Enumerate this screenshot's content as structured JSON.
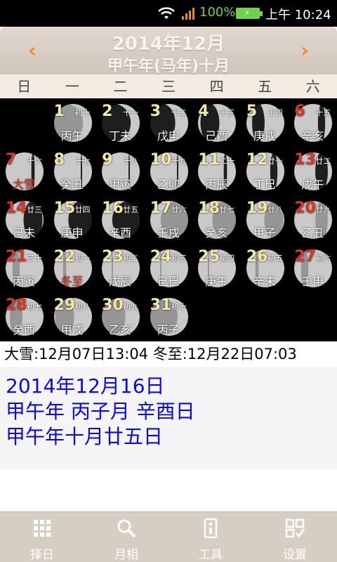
{
  "status": {
    "battery": "100%",
    "time": "上午 10:24"
  },
  "header": {
    "title": "2014年12月",
    "subtitle": "甲午年(马年)十月",
    "prev": "‹",
    "next": "›"
  },
  "weekdays": [
    "日",
    "一",
    "二",
    "三",
    "四",
    "五",
    "六"
  ],
  "days": [
    {
      "d": "1",
      "l": "初十",
      "g": "丙午",
      "c": 1,
      "r": 0,
      "red": false
    },
    {
      "d": "2",
      "l": "十一",
      "g": "丁未",
      "c": 2,
      "r": 0,
      "red": false
    },
    {
      "d": "3",
      "l": "十二",
      "g": "戊申",
      "c": 3,
      "r": 0,
      "red": false
    },
    {
      "d": "4",
      "l": "十三",
      "g": "己酉",
      "c": 4,
      "r": 0,
      "red": false
    },
    {
      "d": "5",
      "l": "十四",
      "g": "庚戌",
      "c": 5,
      "r": 0,
      "red": false
    },
    {
      "d": "6",
      "l": "十五",
      "g": "辛亥",
      "c": 6,
      "r": 0,
      "red": true
    },
    {
      "d": "7",
      "l": "十六",
      "g": "大雪",
      "c": 0,
      "r": 1,
      "red": true,
      "gred": true
    },
    {
      "d": "8",
      "l": "十七",
      "g": "癸丑",
      "c": 1,
      "r": 1,
      "red": false
    },
    {
      "d": "9",
      "l": "十八",
      "g": "甲寅",
      "c": 2,
      "r": 1,
      "red": false
    },
    {
      "d": "10",
      "l": "十九",
      "g": "乙卯",
      "c": 3,
      "r": 1,
      "red": false
    },
    {
      "d": "11",
      "l": "二十",
      "g": "丙辰",
      "c": 4,
      "r": 1,
      "red": false
    },
    {
      "d": "12",
      "l": "廿一",
      "g": "丁巳",
      "c": 5,
      "r": 1,
      "red": false
    },
    {
      "d": "13",
      "l": "廿二",
      "g": "戊午",
      "c": 6,
      "r": 1,
      "red": true
    },
    {
      "d": "14",
      "l": "廿三",
      "g": "己未",
      "c": 0,
      "r": 2,
      "red": true
    },
    {
      "d": "15",
      "l": "廿四",
      "g": "庚申",
      "c": 1,
      "r": 2,
      "red": false
    },
    {
      "d": "16",
      "l": "廿五",
      "g": "辛酉",
      "c": 2,
      "r": 2,
      "red": false
    },
    {
      "d": "17",
      "l": "廿六",
      "g": "壬戌",
      "c": 3,
      "r": 2,
      "red": false
    },
    {
      "d": "18",
      "l": "廿七",
      "g": "癸亥",
      "c": 4,
      "r": 2,
      "red": false
    },
    {
      "d": "19",
      "l": "廿八",
      "g": "甲子",
      "c": 5,
      "r": 2,
      "red": false
    },
    {
      "d": "20",
      "l": "廿九",
      "g": "乙丑",
      "c": 6,
      "r": 2,
      "red": true
    },
    {
      "d": "21",
      "l": "三十",
      "g": "丙寅",
      "c": 0,
      "r": 3,
      "red": true
    },
    {
      "d": "22",
      "l": "初一",
      "g": "冬至",
      "c": 1,
      "r": 3,
      "red": false,
      "gred": true
    },
    {
      "d": "23",
      "l": "初二",
      "g": "戊辰",
      "c": 2,
      "r": 3,
      "red": false
    },
    {
      "d": "24",
      "l": "初三",
      "g": "己巳",
      "c": 3,
      "r": 3,
      "red": false
    },
    {
      "d": "25",
      "l": "初四",
      "g": "庚午",
      "c": 4,
      "r": 3,
      "red": false
    },
    {
      "d": "26",
      "l": "初五",
      "g": "辛未",
      "c": 5,
      "r": 3,
      "red": false
    },
    {
      "d": "27",
      "l": "初六",
      "g": "壬申",
      "c": 6,
      "r": 3,
      "red": true
    },
    {
      "d": "28",
      "l": "初七",
      "g": "癸酉",
      "c": 0,
      "r": 4,
      "red": true
    },
    {
      "d": "29",
      "l": "初八",
      "g": "甲戌",
      "c": 1,
      "r": 4,
      "red": false
    },
    {
      "d": "30",
      "l": "初九",
      "g": "乙亥",
      "c": 2,
      "r": 4,
      "red": false
    },
    {
      "d": "31",
      "l": "初十",
      "g": "丙子",
      "c": 3,
      "r": 4,
      "red": false
    }
  ],
  "terms": "大雪:12月07日13:04  冬至:12月22日07:03",
  "detail": {
    "line1": "2014年12月16日",
    "line2": "甲午年 丙子月 辛酉日",
    "line3": "甲午年十月廿五日"
  },
  "tabs": [
    {
      "label": "择日",
      "icon": "grid-icon"
    },
    {
      "label": "月相",
      "icon": "magnifier-icon"
    },
    {
      "label": "工具",
      "icon": "tool-icon"
    },
    {
      "label": "设置",
      "icon": "settings-icon"
    }
  ]
}
